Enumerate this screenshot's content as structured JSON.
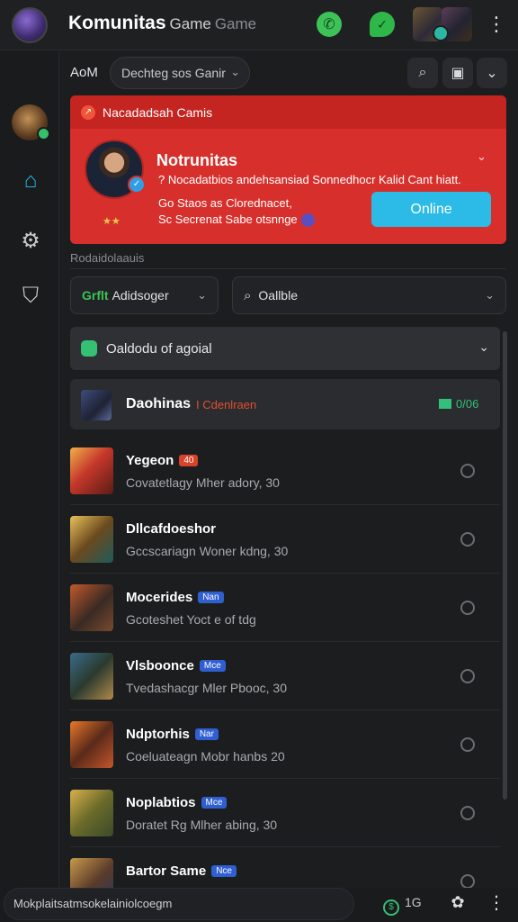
{
  "header": {
    "title": "Komunitas",
    "subtitle": "Game",
    "subtitle2": "Game",
    "icons": [
      "whatsapp-icon",
      "chat-bubble-icon"
    ],
    "menu_glyph": "⋮"
  },
  "rail": {
    "items": [
      "profile-avatar",
      "home-icon",
      "gear-icon",
      "shield-icon"
    ]
  },
  "filter": {
    "label": "AoM",
    "select_value": "Dechteg sos Ganir",
    "chevron": "⌄",
    "search_glyph": "⌕",
    "box_glyph": "▣",
    "down_glyph": "⌄"
  },
  "notification": {
    "header": "Nacadadsah Camis",
    "header_icon": "↗",
    "name": "Notrunitas",
    "line1": "? Nocadatbios andehsansiad Sonnedhocr Kalid Cant hiatt.",
    "line2": "Go Staos as Clorednacet,",
    "line3": "Sc Secrenat Sabe otsnnge",
    "stars": "★★",
    "button_label": "Online",
    "close_glyph": "⌄"
  },
  "section": {
    "label": "Rodaidolaauis"
  },
  "dropdowns": {
    "left": {
      "prefix": "Grflt",
      "value": "Adidsoger",
      "chevron": "⌄"
    },
    "right": {
      "value": "Oallble",
      "chevron": "⌄",
      "search_glyph": "⌕"
    }
  },
  "group": {
    "label": "Oaldodu of agoial",
    "chevron": "⌄"
  },
  "featured": {
    "name": "Daohinas",
    "tag": "I Cdenlraen",
    "count": "0/06"
  },
  "items": [
    {
      "name": "Yegeon",
      "badge": "",
      "badge2": "40",
      "sub": "Covatetlagy Mher adory, 30",
      "thumb": "warrior-red"
    },
    {
      "name": "Dllcafdoeshor",
      "badge": "",
      "badge2": "",
      "sub": "Gccscariagn Woner kdng, 30",
      "thumb": "gunner-yellow"
    },
    {
      "name": "Mocerides",
      "badge": "Nan",
      "badge2": "",
      "sub": "Gcoteshet Yoct e of tdg",
      "thumb": "soldier-orange"
    },
    {
      "name": "Vlsboonce",
      "badge": "Mce",
      "badge2": "",
      "sub": "Tvedashacgr Mler Pbooc, 30",
      "thumb": "rifle-blue"
    },
    {
      "name": "Ndptorhis",
      "badge": "Nar",
      "badge2": "",
      "sub": "Coeluateagn Mobr hanbs 20",
      "thumb": "gunner-orange"
    },
    {
      "name": "Noplabtios",
      "badge": "Mce",
      "badge2": "",
      "sub": "Doratet Rg Mlher abing, 30",
      "thumb": "ranger-yellow"
    },
    {
      "name": "Bartor Same",
      "badge": "Nce",
      "badge2": "",
      "sub": "",
      "thumb": "warrior-gold"
    }
  ],
  "bottom": {
    "input_value": "Mokplaitsatmsokelainiolcoegm",
    "count": "1G",
    "count_glyph": "$",
    "menu_glyph": "⋮",
    "icon_glyph": "✿"
  },
  "colors": {
    "accent_red": "#d7302c",
    "accent_cyan": "#2bbbe6",
    "accent_green": "#35c074",
    "background": "#1c1d1f"
  }
}
